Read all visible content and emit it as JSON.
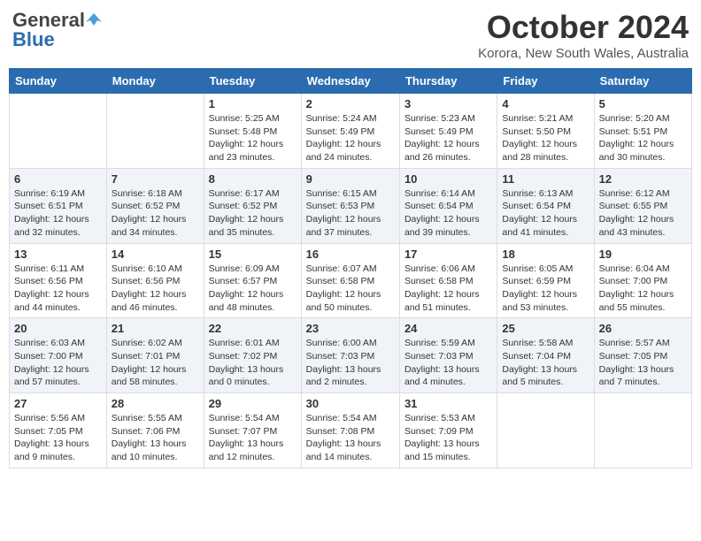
{
  "header": {
    "logo_general": "General",
    "logo_blue": "Blue",
    "month_title": "October 2024",
    "location": "Korora, New South Wales, Australia"
  },
  "weekdays": [
    "Sunday",
    "Monday",
    "Tuesday",
    "Wednesday",
    "Thursday",
    "Friday",
    "Saturday"
  ],
  "weeks": [
    [
      {
        "day": "",
        "info": ""
      },
      {
        "day": "",
        "info": ""
      },
      {
        "day": "1",
        "info": "Sunrise: 5:25 AM\nSunset: 5:48 PM\nDaylight: 12 hours\nand 23 minutes."
      },
      {
        "day": "2",
        "info": "Sunrise: 5:24 AM\nSunset: 5:49 PM\nDaylight: 12 hours\nand 24 minutes."
      },
      {
        "day": "3",
        "info": "Sunrise: 5:23 AM\nSunset: 5:49 PM\nDaylight: 12 hours\nand 26 minutes."
      },
      {
        "day": "4",
        "info": "Sunrise: 5:21 AM\nSunset: 5:50 PM\nDaylight: 12 hours\nand 28 minutes."
      },
      {
        "day": "5",
        "info": "Sunrise: 5:20 AM\nSunset: 5:51 PM\nDaylight: 12 hours\nand 30 minutes."
      }
    ],
    [
      {
        "day": "6",
        "info": "Sunrise: 6:19 AM\nSunset: 6:51 PM\nDaylight: 12 hours\nand 32 minutes."
      },
      {
        "day": "7",
        "info": "Sunrise: 6:18 AM\nSunset: 6:52 PM\nDaylight: 12 hours\nand 34 minutes."
      },
      {
        "day": "8",
        "info": "Sunrise: 6:17 AM\nSunset: 6:52 PM\nDaylight: 12 hours\nand 35 minutes."
      },
      {
        "day": "9",
        "info": "Sunrise: 6:15 AM\nSunset: 6:53 PM\nDaylight: 12 hours\nand 37 minutes."
      },
      {
        "day": "10",
        "info": "Sunrise: 6:14 AM\nSunset: 6:54 PM\nDaylight: 12 hours\nand 39 minutes."
      },
      {
        "day": "11",
        "info": "Sunrise: 6:13 AM\nSunset: 6:54 PM\nDaylight: 12 hours\nand 41 minutes."
      },
      {
        "day": "12",
        "info": "Sunrise: 6:12 AM\nSunset: 6:55 PM\nDaylight: 12 hours\nand 43 minutes."
      }
    ],
    [
      {
        "day": "13",
        "info": "Sunrise: 6:11 AM\nSunset: 6:56 PM\nDaylight: 12 hours\nand 44 minutes."
      },
      {
        "day": "14",
        "info": "Sunrise: 6:10 AM\nSunset: 6:56 PM\nDaylight: 12 hours\nand 46 minutes."
      },
      {
        "day": "15",
        "info": "Sunrise: 6:09 AM\nSunset: 6:57 PM\nDaylight: 12 hours\nand 48 minutes."
      },
      {
        "day": "16",
        "info": "Sunrise: 6:07 AM\nSunset: 6:58 PM\nDaylight: 12 hours\nand 50 minutes."
      },
      {
        "day": "17",
        "info": "Sunrise: 6:06 AM\nSunset: 6:58 PM\nDaylight: 12 hours\nand 51 minutes."
      },
      {
        "day": "18",
        "info": "Sunrise: 6:05 AM\nSunset: 6:59 PM\nDaylight: 12 hours\nand 53 minutes."
      },
      {
        "day": "19",
        "info": "Sunrise: 6:04 AM\nSunset: 7:00 PM\nDaylight: 12 hours\nand 55 minutes."
      }
    ],
    [
      {
        "day": "20",
        "info": "Sunrise: 6:03 AM\nSunset: 7:00 PM\nDaylight: 12 hours\nand 57 minutes."
      },
      {
        "day": "21",
        "info": "Sunrise: 6:02 AM\nSunset: 7:01 PM\nDaylight: 12 hours\nand 58 minutes."
      },
      {
        "day": "22",
        "info": "Sunrise: 6:01 AM\nSunset: 7:02 PM\nDaylight: 13 hours\nand 0 minutes."
      },
      {
        "day": "23",
        "info": "Sunrise: 6:00 AM\nSunset: 7:03 PM\nDaylight: 13 hours\nand 2 minutes."
      },
      {
        "day": "24",
        "info": "Sunrise: 5:59 AM\nSunset: 7:03 PM\nDaylight: 13 hours\nand 4 minutes."
      },
      {
        "day": "25",
        "info": "Sunrise: 5:58 AM\nSunset: 7:04 PM\nDaylight: 13 hours\nand 5 minutes."
      },
      {
        "day": "26",
        "info": "Sunrise: 5:57 AM\nSunset: 7:05 PM\nDaylight: 13 hours\nand 7 minutes."
      }
    ],
    [
      {
        "day": "27",
        "info": "Sunrise: 5:56 AM\nSunset: 7:05 PM\nDaylight: 13 hours\nand 9 minutes."
      },
      {
        "day": "28",
        "info": "Sunrise: 5:55 AM\nSunset: 7:06 PM\nDaylight: 13 hours\nand 10 minutes."
      },
      {
        "day": "29",
        "info": "Sunrise: 5:54 AM\nSunset: 7:07 PM\nDaylight: 13 hours\nand 12 minutes."
      },
      {
        "day": "30",
        "info": "Sunrise: 5:54 AM\nSunset: 7:08 PM\nDaylight: 13 hours\nand 14 minutes."
      },
      {
        "day": "31",
        "info": "Sunrise: 5:53 AM\nSunset: 7:09 PM\nDaylight: 13 hours\nand 15 minutes."
      },
      {
        "day": "",
        "info": ""
      },
      {
        "day": "",
        "info": ""
      }
    ]
  ]
}
